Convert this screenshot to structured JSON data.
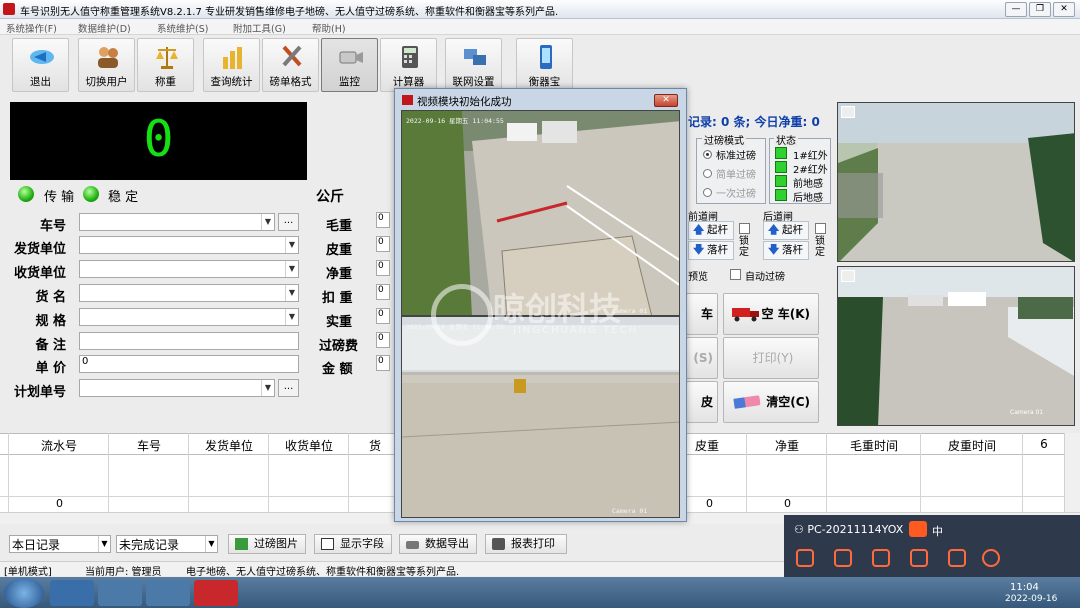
{
  "window": {
    "title": "车号识别无人值守称重管理系统V8.2.1.7  专业研发销售维修电子地磅、无人值守过磅系统、称重软件和衡器宝等系列产品.",
    "minimize": "—",
    "restore": "❐",
    "close": "✕"
  },
  "menu": [
    "系统操作(F)",
    "数据维护(D)",
    "系统维护(S)",
    "附加工具(G)",
    "帮助(H)"
  ],
  "toolbar": [
    {
      "label": "退出",
      "icon": "exit-icon"
    },
    {
      "label": "切换用户",
      "icon": "users-icon"
    },
    {
      "label": "称重",
      "icon": "scale-icon"
    },
    {
      "label": "查询统计",
      "icon": "chart-icon"
    },
    {
      "label": "磅单格式",
      "icon": "tools-icon"
    },
    {
      "label": "监控",
      "icon": "camera-icon"
    },
    {
      "label": "计算器",
      "icon": "calculator-icon"
    },
    {
      "label": "联网设置",
      "icon": "network-icon"
    },
    {
      "label": "衡器宝",
      "icon": "phone-icon"
    }
  ],
  "weight": {
    "value": "0",
    "unit": "公斤",
    "transmit_label": "传 输",
    "stable_label": "稳 定"
  },
  "form": {
    "vehicle_label": "车号",
    "sender_label": "发货单位",
    "receiver_label": "收货单位",
    "goods_label": "货 名",
    "spec_label": "规 格",
    "remark_label": "备 注",
    "price_label": "单 价",
    "price_value": "0",
    "plan_label": "计划单号",
    "more": "..."
  },
  "right_fields": {
    "gross_label": "毛重",
    "tare_label": "皮重",
    "net_label": "净重",
    "deduct_label": "扣 重",
    "actual_label": "实重",
    "fee_label": "过磅费",
    "amount_label": "金 额",
    "zero": "0"
  },
  "records": {
    "summary": "记录: 0 条; 今日净重: 0"
  },
  "mode": {
    "title": "过磅模式",
    "options": [
      "标准过磅",
      "简单过磅",
      "一次过磅"
    ]
  },
  "status": {
    "title": "状态",
    "items": [
      "1#红外",
      "2#红外",
      "前地感",
      "后地感"
    ]
  },
  "gates": {
    "front_title": "前道闸",
    "rear_title": "后道闸",
    "raise": "起杆",
    "lower": "落杆",
    "lock": "锁定"
  },
  "options": {
    "preview": "预览",
    "auto_weigh": "自动过磅"
  },
  "buttons": {
    "print_partial": "车(Z)",
    "empty_truck": "空 车(K)",
    "save_partial": "(S)",
    "print": "打印(Y)",
    "clear_partial": "皮",
    "clear": "清空(C)"
  },
  "grid": {
    "left_headers": [
      "流水号",
      "车号",
      "发货单位",
      "收货单位",
      "货"
    ],
    "right_headers": [
      "皮重",
      "净重",
      "毛重时间",
      "皮重时间",
      "6"
    ],
    "sum_values": [
      "0",
      "0",
      "0"
    ]
  },
  "bottom": {
    "range_select": "本日记录",
    "status_select": "未完成记录",
    "btn_images": "过磅图片",
    "btn_fields": "显示字段",
    "btn_export": "数据导出",
    "btn_print": "报表打印"
  },
  "statusbar": {
    "mode": "[单机模式]",
    "user": "当前用户: 管理员",
    "ad": "电子地磅、无人值守过磅系统、称重软件和衡器宝等系列产品."
  },
  "modal": {
    "title": "视频模块初始化成功",
    "close": "✕",
    "watermark_main": "晾创科技",
    "watermark_sub": "JINGCHUANG TECH",
    "cam1_time": "2022-09-16 星期五 11:04:55",
    "cam1_label": "Camera 01",
    "cam2_time": "2022-09-16 星期五 11:04:53",
    "cam2_label": "Camera 01"
  },
  "right_cams": {
    "cam_label": "Camera 01"
  },
  "ime": {
    "user": "PC-20211114YOX",
    "ch": "中"
  },
  "taskbar": {
    "time": "11:04",
    "date": "2022-09-16"
  },
  "colors": {
    "weight_digits": "#14e014",
    "accent_blue": "#0f3fa8",
    "led_green": "#2fd12f"
  }
}
